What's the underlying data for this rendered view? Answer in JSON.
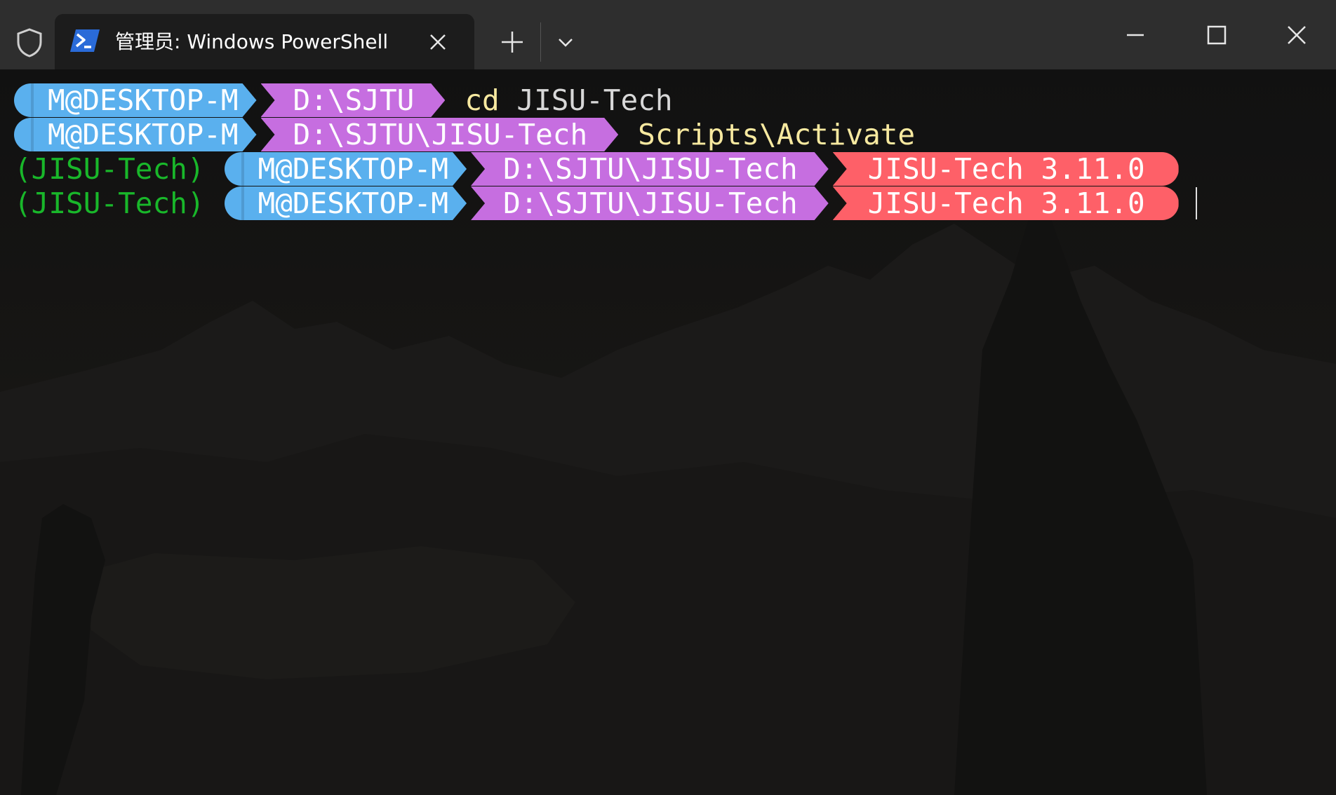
{
  "window": {
    "tab_title": "管理员: Windows PowerShell",
    "icons": {
      "shield": "shield-icon",
      "tab": "powershell-icon",
      "tab_close": "close-icon",
      "new_tab": "plus-icon",
      "dropdown": "chevron-down-icon",
      "minimize": "minimize-icon",
      "maximize": "maximize-icon",
      "close": "close-icon"
    }
  },
  "colors": {
    "user_segment": "#5ab0ee",
    "path_segment": "#c66ee0",
    "env_segment": "#fe6068",
    "venv_text": "#19b72a",
    "command_keyword": "#f7e9a0"
  },
  "terminal": {
    "lines": [
      {
        "venv": "",
        "user": "M@DESKTOP-M",
        "path": "D:\\SJTU",
        "env": "",
        "cmd_keyword": "cd",
        "cmd_args": "JISU-Tech"
      },
      {
        "venv": "",
        "user": "M@DESKTOP-M",
        "path": "D:\\SJTU\\JISU-Tech",
        "env": "",
        "cmd_keyword": "Scripts\\Activate",
        "cmd_args": ""
      },
      {
        "venv": "(JISU-Tech)",
        "user": "M@DESKTOP-M",
        "path": "D:\\SJTU\\JISU-Tech",
        "env": "JISU-Tech 3.11.0",
        "cmd_keyword": "",
        "cmd_args": ""
      },
      {
        "venv": "(JISU-Tech)",
        "user": "M@DESKTOP-M",
        "path": "D:\\SJTU\\JISU-Tech",
        "env": "JISU-Tech 3.11.0",
        "cmd_keyword": "",
        "cmd_args": ""
      }
    ]
  }
}
